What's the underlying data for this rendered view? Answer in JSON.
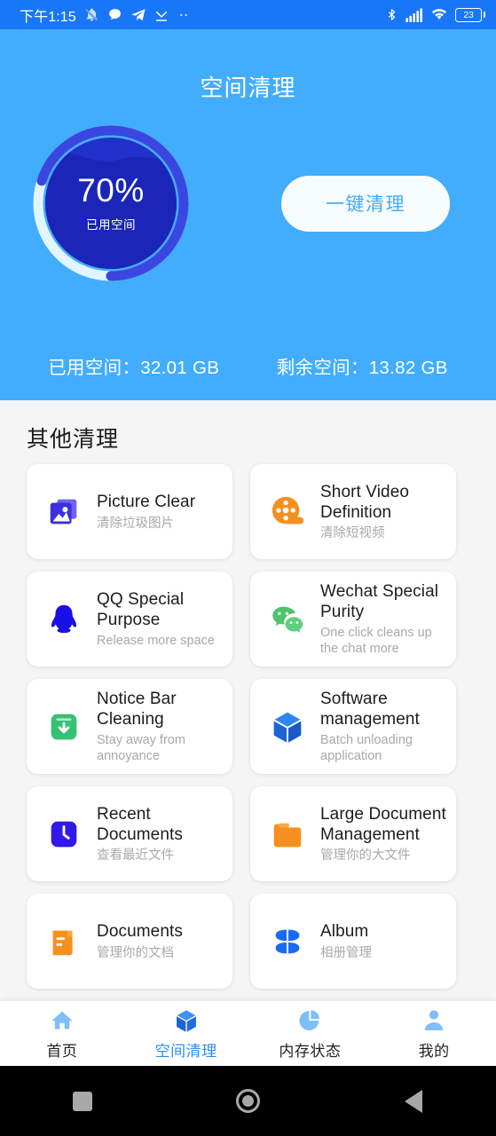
{
  "status_bar": {
    "time": "下午1:15",
    "battery_level": "23",
    "left_icons": [
      "mute-bell-icon",
      "chat-bubble-icon",
      "telegram-icon",
      "download-icon",
      "more-dots-icon"
    ],
    "right_icons": [
      "bluetooth-icon",
      "signal-bars-icon",
      "wifi-icon",
      "battery-icon"
    ],
    "background_color": "#1877F9"
  },
  "header": {
    "title": "空间清理",
    "background_color": "#42ADFC",
    "gauge": {
      "percent_label": "70%",
      "percent_value": 70,
      "caption": "已用空间",
      "arc_color": "#3A46E0",
      "track_color": "#E2F5FE",
      "fill_color": "#2030C8"
    },
    "clean_button": "一键清理",
    "stats": {
      "used": "已用空间：32.01 GB",
      "free": "剩余空间：13.82 GB"
    }
  },
  "main": {
    "section_title": "其他清理",
    "cards": [
      {
        "title": "Picture Clear",
        "subtitle": "清除垃圾图片",
        "icon": "picture-icon",
        "color": "#3B2FE0"
      },
      {
        "title": "Short Video Definition",
        "subtitle": "清除短视频",
        "icon": "film-reel-icon",
        "color": "#F5901E"
      },
      {
        "title": "QQ Special Purpose",
        "subtitle": "Release more space",
        "icon": "qq-penguin-icon",
        "color": "#1A0FE8"
      },
      {
        "title": "Wechat Special Purity",
        "subtitle": "One click cleans up the chat more",
        "icon": "wechat-icon",
        "color": "#4CC56B"
      },
      {
        "title": "Notice Bar Cleaning",
        "subtitle": "Stay away from annoyance",
        "icon": "notice-download-icon",
        "color": "#36C173"
      },
      {
        "title": "Software management",
        "subtitle": "Batch unloading application",
        "icon": "cube-icon",
        "color": "#1F6BE0"
      },
      {
        "title": "Recent Documents",
        "subtitle": "查看最近文件",
        "icon": "clock-icon",
        "color": "#3118EB"
      },
      {
        "title": "Large Document Management",
        "subtitle": "管理你的大文件",
        "icon": "folder-icon",
        "color": "#F5901E"
      },
      {
        "title": "Documents",
        "subtitle": "管理你的文档",
        "icon": "document-icon",
        "color": "#F5901E"
      },
      {
        "title": "Album",
        "subtitle": "相册管理",
        "icon": "clover-album-icon",
        "color": "#1A6BF0"
      }
    ]
  },
  "bottom_nav": {
    "active_color": "#2D8CF0",
    "items": [
      {
        "label": "首页",
        "icon": "home-icon",
        "active": false
      },
      {
        "label": "空间清理",
        "icon": "cube-icon",
        "active": true
      },
      {
        "label": "内存状态",
        "icon": "pie-chart-icon",
        "active": false
      },
      {
        "label": "我的",
        "icon": "person-icon",
        "active": false
      }
    ]
  },
  "system_nav": {
    "buttons": [
      "recents-square-icon",
      "home-circle-icon",
      "back-triangle-icon"
    ]
  }
}
